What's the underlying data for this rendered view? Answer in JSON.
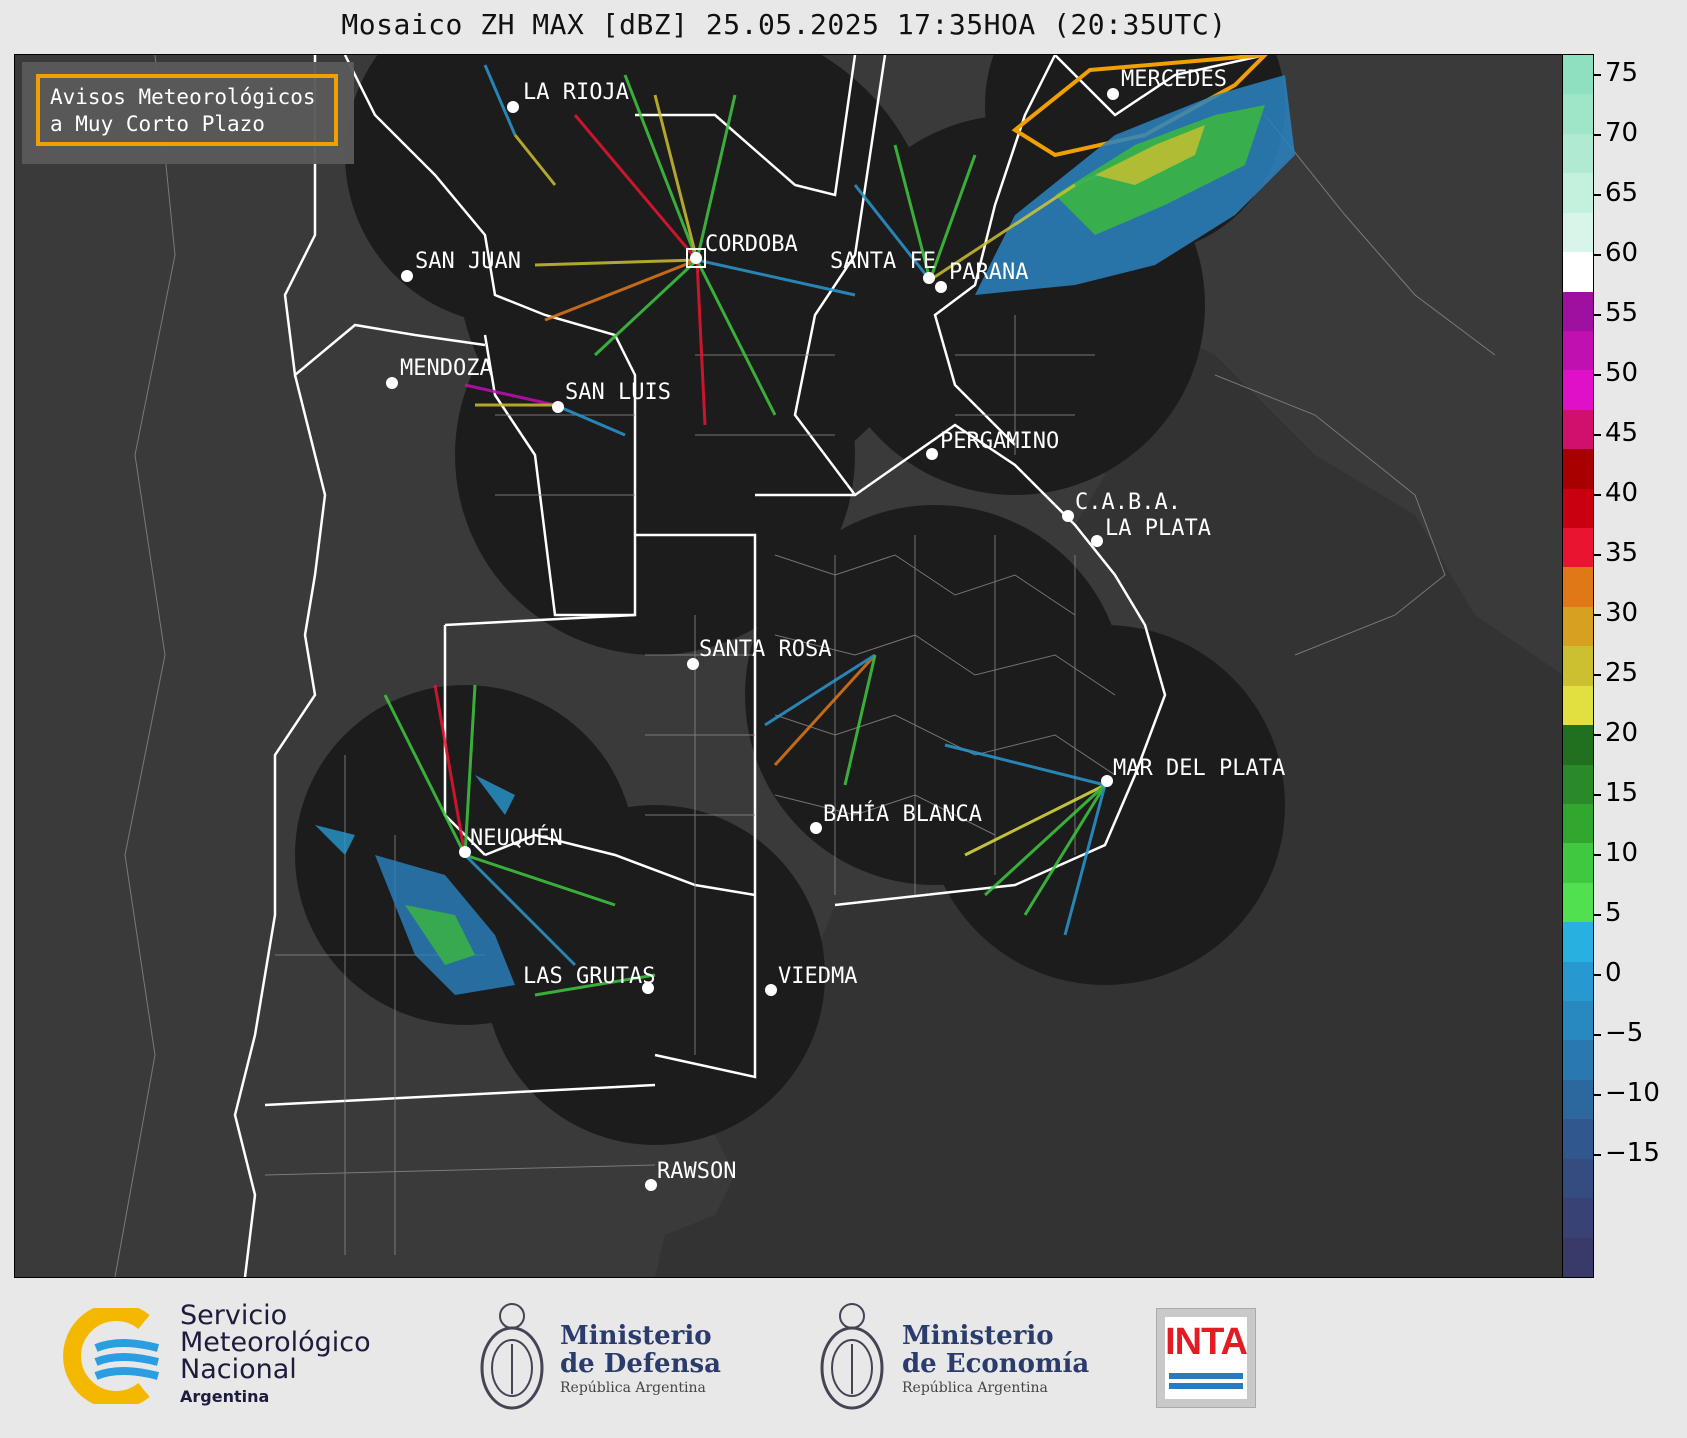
{
  "title": "Mosaico ZH MAX [dBZ] 25.05.2025 17:35HOA (20:35UTC)",
  "notice": {
    "line1": "Avisos Meteorológicos",
    "line2": "a Muy Corto Plazo"
  },
  "cities": [
    {
      "name": "LA RIOJA"
    },
    {
      "name": "CORDOBA"
    },
    {
      "name": "SAN JUAN"
    },
    {
      "name": "SANTA FE"
    },
    {
      "name": "PARANA"
    },
    {
      "name": "MERCEDES"
    },
    {
      "name": "MENDOZA"
    },
    {
      "name": "SAN LUIS"
    },
    {
      "name": "PERGAMINO"
    },
    {
      "name": "C.A.B.A."
    },
    {
      "name": "LA PLATA"
    },
    {
      "name": "SANTA ROSA"
    },
    {
      "name": "MAR DEL PLATA"
    },
    {
      "name": "BAHÍA BLANCA"
    },
    {
      "name": "NEUQUÉN"
    },
    {
      "name": "LAS GRUTAS"
    },
    {
      "name": "VIEDMA"
    },
    {
      "name": "RAWSON"
    }
  ],
  "colorbar": {
    "ticks": [
      "75",
      "70",
      "65",
      "60",
      "55",
      "50",
      "45",
      "40",
      "35",
      "30",
      "25",
      "20",
      "15",
      "10",
      "5",
      "0",
      "−5",
      "−10",
      "−15"
    ],
    "segments": [
      {
        "c": "#8fe0c0"
      },
      {
        "c": "#9fe5c8"
      },
      {
        "c": "#b0ead2"
      },
      {
        "c": "#c4f0de"
      },
      {
        "c": "#d8f5ea"
      },
      {
        "c": "#ffffff"
      },
      {
        "c": "#a010a0"
      },
      {
        "c": "#c010b0"
      },
      {
        "c": "#e010c8"
      },
      {
        "c": "#d0106a"
      },
      {
        "c": "#a80000"
      },
      {
        "c": "#c80010"
      },
      {
        "c": "#e81430"
      },
      {
        "c": "#e07818"
      },
      {
        "c": "#d8a020"
      },
      {
        "c": "#cdc030"
      },
      {
        "c": "#e0e040"
      },
      {
        "c": "#207020"
      },
      {
        "c": "#288a28"
      },
      {
        "c": "#30a830"
      },
      {
        "c": "#40c840"
      },
      {
        "c": "#50e050"
      },
      {
        "c": "#28b0e0"
      },
      {
        "c": "#2898d0"
      },
      {
        "c": "#2888c0"
      },
      {
        "c": "#2a78b0"
      },
      {
        "c": "#2c689e"
      },
      {
        "c": "#30588e"
      },
      {
        "c": "#344c80"
      },
      {
        "c": "#384274"
      },
      {
        "c": "#3a3a68"
      }
    ]
  },
  "logos": {
    "smn_line1": "Servicio",
    "smn_line2": "Meteorológico",
    "smn_line3": "Nacional",
    "smn_sub": "Argentina",
    "defensa_line1": "Ministerio",
    "defensa_line2": "de Defensa",
    "defensa_sub": "República Argentina",
    "economia_line1": "Ministerio",
    "economia_line2": "de Economía",
    "economia_sub": "República Argentina",
    "inta": "INTA"
  }
}
